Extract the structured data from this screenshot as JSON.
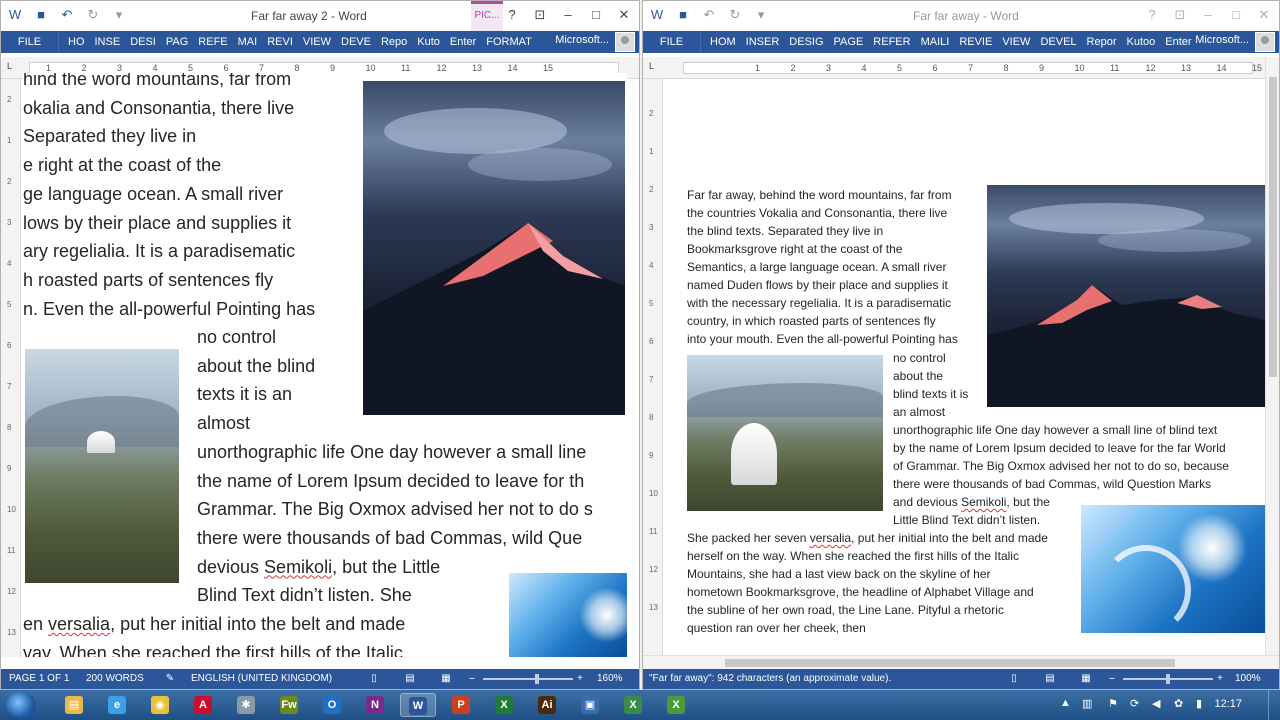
{
  "left_window": {
    "title": "Far far away 2 - Word",
    "context_tab": "PIC...",
    "help": "?",
    "file_tab": "FILE",
    "tabs": [
      "HO",
      "INSE",
      "DESI",
      "PAG",
      "REFE",
      "MAI",
      "REVI",
      "VIEW",
      "DEVE",
      "Repo",
      "Kuto",
      "Enter",
      "FORMAT"
    ],
    "account": "Microsoft...",
    "ruler_numbers": [
      "1",
      "2",
      "3",
      "4",
      "5",
      "6",
      "7",
      "8",
      "9",
      "10",
      "11",
      "12",
      "13",
      "14",
      "15"
    ],
    "vruler_numbers": [
      "2",
      "1",
      "2",
      "3",
      "4",
      "5",
      "6",
      "7",
      "8",
      "9",
      "10",
      "11",
      "12",
      "13"
    ],
    "lines": [
      "hind the word mountains, far from",
      "okalia and Consonantia, there live",
      " Separated they live in",
      "e right at the coast of the",
      "ge language ocean. A small river",
      "lows by their place and supplies it",
      "ary regelialia. It is a paradisematic",
      "h roasted parts of sentences fly",
      "n. Even the all-powerful Pointing has"
    ],
    "wrap_lines": [
      "no control",
      "about the blind",
      "texts it is an",
      "almost"
    ],
    "full_lines": [
      "unorthographic life One day however a small line",
      "the name of Lorem Ipsum decided to leave for th",
      "Grammar. The Big Oxmox advised her not to do s",
      "there were thousands of bad Commas, wild Que"
    ],
    "semikoli_line": {
      "pre": "devious ",
      "word": "Semikoli",
      "post": ", but the Little"
    },
    "blind_line": "Blind Text didn’t listen. She",
    "versalia_line": {
      "pre": "en ",
      "word": "versalia",
      "post": ", put her initial into the belt and made"
    },
    "last_line": "vay. When she reached the first hills of the Italic",
    "status": {
      "page": "PAGE 1 OF 1",
      "words": "200 WORDS",
      "language": "ENGLISH (UNITED KINGDOM)",
      "zoom": "160%"
    }
  },
  "right_window": {
    "title": "Far far away - Word",
    "help": "?",
    "file_tab": "FILE",
    "tabs": [
      "HOM",
      "INSER",
      "DESIG",
      "PAGE",
      "REFER",
      "MAILI",
      "REVIE",
      "VIEW",
      "DEVEL",
      "Repor",
      "Kutoo",
      "Enter"
    ],
    "account": "Microsoft...",
    "ruler_numbers": [
      "1",
      "2",
      "3",
      "4",
      "5",
      "6",
      "7",
      "8",
      "9",
      "10",
      "11",
      "12",
      "13",
      "14",
      "15"
    ],
    "vruler_numbers": [
      "2",
      "1",
      "2",
      "3",
      "4",
      "5",
      "6",
      "7",
      "8",
      "9",
      "10",
      "11",
      "12",
      "13"
    ],
    "top_lines": [
      "Far far away, behind the word mountains, far from",
      "the countries Vokalia and Consonantia, there live",
      "the blind texts. Separated they live in",
      "Bookmarksgrove right at the coast of the",
      "Semantics, a large language ocean. A small river",
      "named Duden flows by their place and supplies it",
      "with the necessary regelialia. It is a paradisematic",
      "country, in which roasted parts of sentences fly",
      "into your mouth. Even the all-powerful Pointing has"
    ],
    "wrap_lines": [
      "no control",
      "about the",
      "blind texts it is",
      "an almost",
      "unorthographic life One day however a small line of blind text",
      "by the name of Lorem Ipsum decided to leave for the far World",
      "of Grammar. The Big Oxmox advised her not to do so, because",
      "there were thousands of bad Commas, wild Question Marks"
    ],
    "semikoli_line": {
      "pre": "and devious ",
      "word": "Semikoli",
      "post": ", but the"
    },
    "little_line": "Little Blind Text didn’t listen.",
    "versalia_line": {
      "pre": "She packed her seven ",
      "word": "versalia",
      "post": ", put her initial into the belt and made"
    },
    "bottom_lines": [
      "herself on the way. When she reached the first hills of the Italic",
      "Mountains, she had a last view back on the skyline of her",
      "hometown Bookmarksgrove, the headline of Alphabet Village and",
      "the subline of her own road, the Line Lane. Pityful a rhetoric",
      "question ran over her cheek, then"
    ],
    "status": {
      "chars": "\"Far far away\": 942 characters (an approximate value).",
      "zoom": "100%"
    }
  },
  "zoom_levels": {
    "left": 0.6,
    "right": 0.5
  },
  "taskbar": {
    "apps": [
      {
        "name": "explorer",
        "glyph": "▤",
        "color": "#e8b84a"
      },
      {
        "name": "ie",
        "glyph": "e",
        "color": "#3aa0e8"
      },
      {
        "name": "chrome",
        "glyph": "◉",
        "color": "#e8c23a"
      },
      {
        "name": "acrobat",
        "glyph": "A",
        "color": "#c8102e"
      },
      {
        "name": "tool",
        "glyph": "✱",
        "color": "#8a9aaa"
      },
      {
        "name": "fw",
        "glyph": "Fw",
        "color": "#6a8a1e"
      },
      {
        "name": "outlook",
        "glyph": "O",
        "color": "#1f6fc4"
      },
      {
        "name": "onenote",
        "glyph": "N",
        "color": "#7a2a8a"
      },
      {
        "name": "word",
        "glyph": "W",
        "color": "#2b579a"
      },
      {
        "name": "powerpoint",
        "glyph": "P",
        "color": "#c8401e"
      },
      {
        "name": "excel",
        "glyph": "X",
        "color": "#1f7a3a"
      },
      {
        "name": "illustrator",
        "glyph": "Ai",
        "color": "#4a2a0a"
      },
      {
        "name": "remote",
        "glyph": "▣",
        "color": "#3a6aa8"
      },
      {
        "name": "excel2",
        "glyph": "X",
        "color": "#3a8a4a"
      },
      {
        "name": "excel3",
        "glyph": "X",
        "color": "#4a9a3a"
      }
    ],
    "clock": "12:17"
  }
}
